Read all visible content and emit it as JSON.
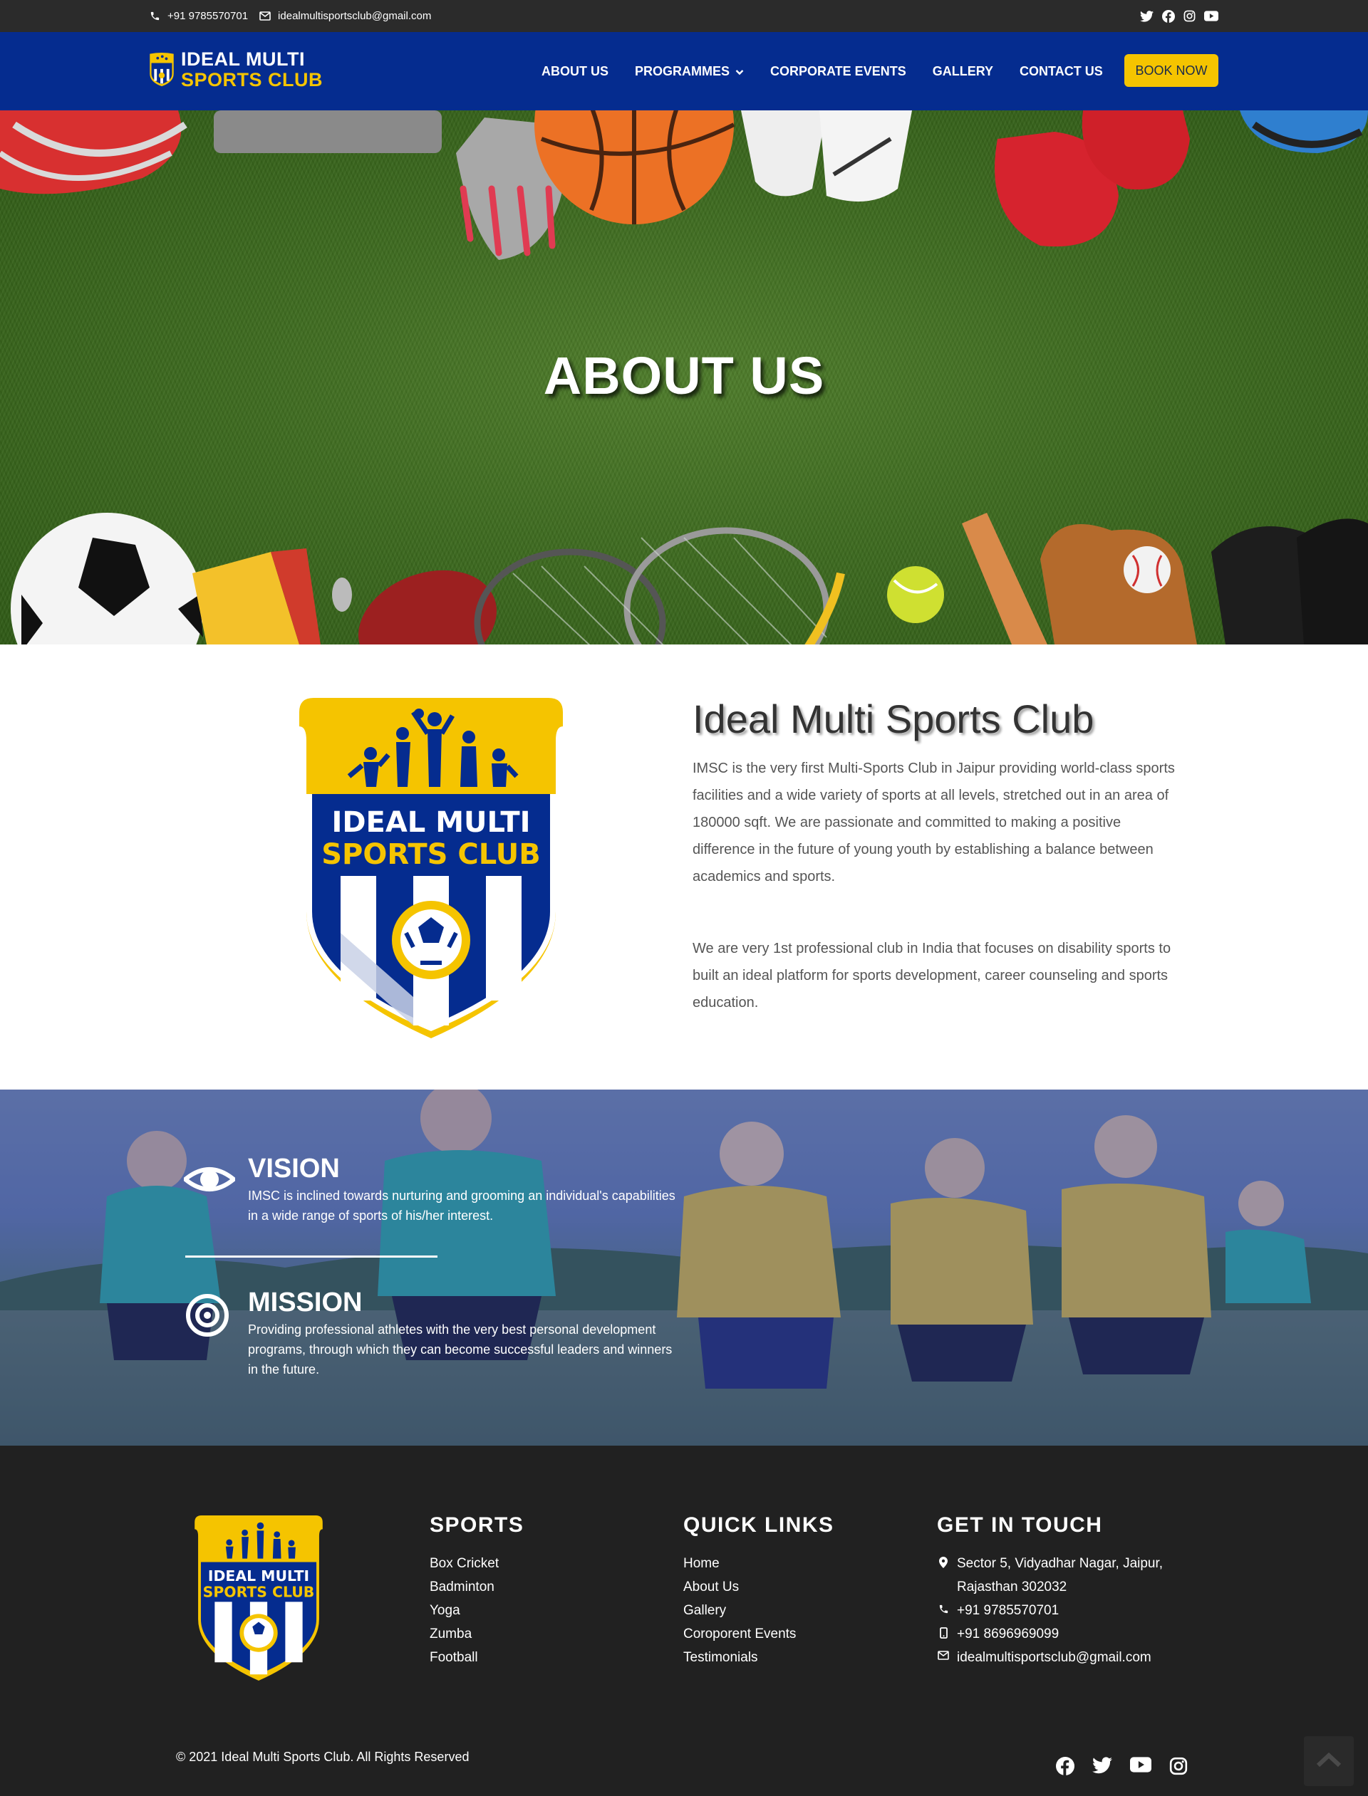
{
  "topbar": {
    "phone": "+91 9785570701",
    "email": "idealmultisportsclub@gmail.com",
    "social_icons": [
      "twitter-icon",
      "facebook-icon",
      "instagram-icon",
      "youtube-icon"
    ]
  },
  "brand": {
    "line1": "IDEAL MULTI",
    "line2": "SPORTS CLUB"
  },
  "nav": {
    "items": [
      {
        "label": "ABOUT US"
      },
      {
        "label": "PROGRAMMES"
      },
      {
        "label": "CORPORATE EVENTS"
      },
      {
        "label": "GALLERY"
      },
      {
        "label": "CONTACT US"
      }
    ],
    "book_label": "BOOK NOW"
  },
  "hero": {
    "title": "ABOUT US"
  },
  "about": {
    "heading": "Ideal Multi Sports Club",
    "paragraph1": "IMSC is the very first Multi-Sports Club in Jaipur providing world-class sports facilities and a wide variety of sports at all levels, stretched out in an area of 180000 sqft. We are passionate and committed to making a positive difference in the future of young youth by establishing a balance between academics and sports.",
    "paragraph2": "We are very 1st professional club in India that focuses on disability sports to built an ideal platform for sports development, career counseling and sports education."
  },
  "vision": {
    "title": "VISION",
    "text": "IMSC is inclined towards nurturing and grooming an individual's capabilities in a wide range of sports of his/her interest."
  },
  "mission": {
    "title": "MISSION",
    "text": "Providing professional athletes with the very best personal development programs, through which they can become successful leaders and winners in the future."
  },
  "footer": {
    "sports": {
      "title": "SPORTS",
      "items": [
        "Box Cricket",
        "Badminton",
        "Yoga",
        "Zumba",
        "Football"
      ]
    },
    "quick_links": {
      "title": "QUICK LINKS",
      "items": [
        "Home",
        "About Us",
        "Gallery",
        "Coroporent Events",
        "Testimonials"
      ]
    },
    "contact": {
      "title": "GET IN TOUCH",
      "address_line1": "Sector 5, Vidyadhar Nagar, Jaipur,",
      "address_line2": "Rajasthan 302032",
      "phone1": "+91 9785570701",
      "phone2": "+91 8696969099",
      "email": "idealmultisportsclub@gmail.com"
    },
    "copyright": "© 2021 Ideal Multi Sports Club. All Rights Reserved",
    "social_icons": [
      "facebook-icon",
      "twitter-icon",
      "youtube-icon",
      "instagram-icon"
    ]
  },
  "colors": {
    "nav_blue": "#052c8f",
    "brand_yellow": "#f5c400",
    "topbar": "#2b2b2b",
    "footer": "#212121"
  }
}
